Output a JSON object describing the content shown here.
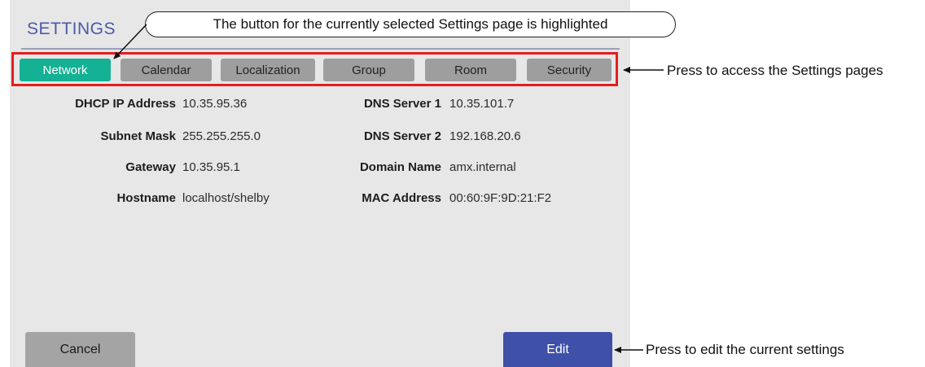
{
  "settings": {
    "title": "SETTINGS",
    "tabs": [
      {
        "label": "Network",
        "active": true
      },
      {
        "label": "Calendar",
        "active": false
      },
      {
        "label": "Localization",
        "active": false
      },
      {
        "label": "Group",
        "active": false
      },
      {
        "label": "Room",
        "active": false
      },
      {
        "label": "Security",
        "active": false
      }
    ],
    "network": {
      "left": [
        {
          "label": "DHCP IP Address",
          "value": "10.35.95.36"
        },
        {
          "label": "Subnet Mask",
          "value": "255.255.255.0"
        },
        {
          "label": "Gateway",
          "value": "10.35.95.1"
        },
        {
          "label": "Hostname",
          "value": "localhost/shelby"
        }
      ],
      "right": [
        {
          "label": "DNS Server 1",
          "value": "10.35.101.7"
        },
        {
          "label": "DNS Server 2",
          "value": "192.168.20.6"
        },
        {
          "label": "Domain Name",
          "value": "amx.internal"
        },
        {
          "label": "MAC Address",
          "value": "00:60:9F:9D:21:F2"
        }
      ]
    },
    "buttons": {
      "cancel": "Cancel",
      "edit": "Edit"
    }
  },
  "annotations": {
    "highlight_callout": "The button for the currently selected Settings page is highlighted",
    "tabs_note": "Press to access the Settings pages",
    "edit_note": "Press to edit the current settings"
  },
  "colors": {
    "active_tab": "#14b194",
    "inactive_tab": "#9e9e9e",
    "edit_button": "#3e50a8",
    "cancel_button": "#a4a4a4",
    "tabbar_outline": "#e41e1e",
    "title": "#4a5aa6"
  }
}
